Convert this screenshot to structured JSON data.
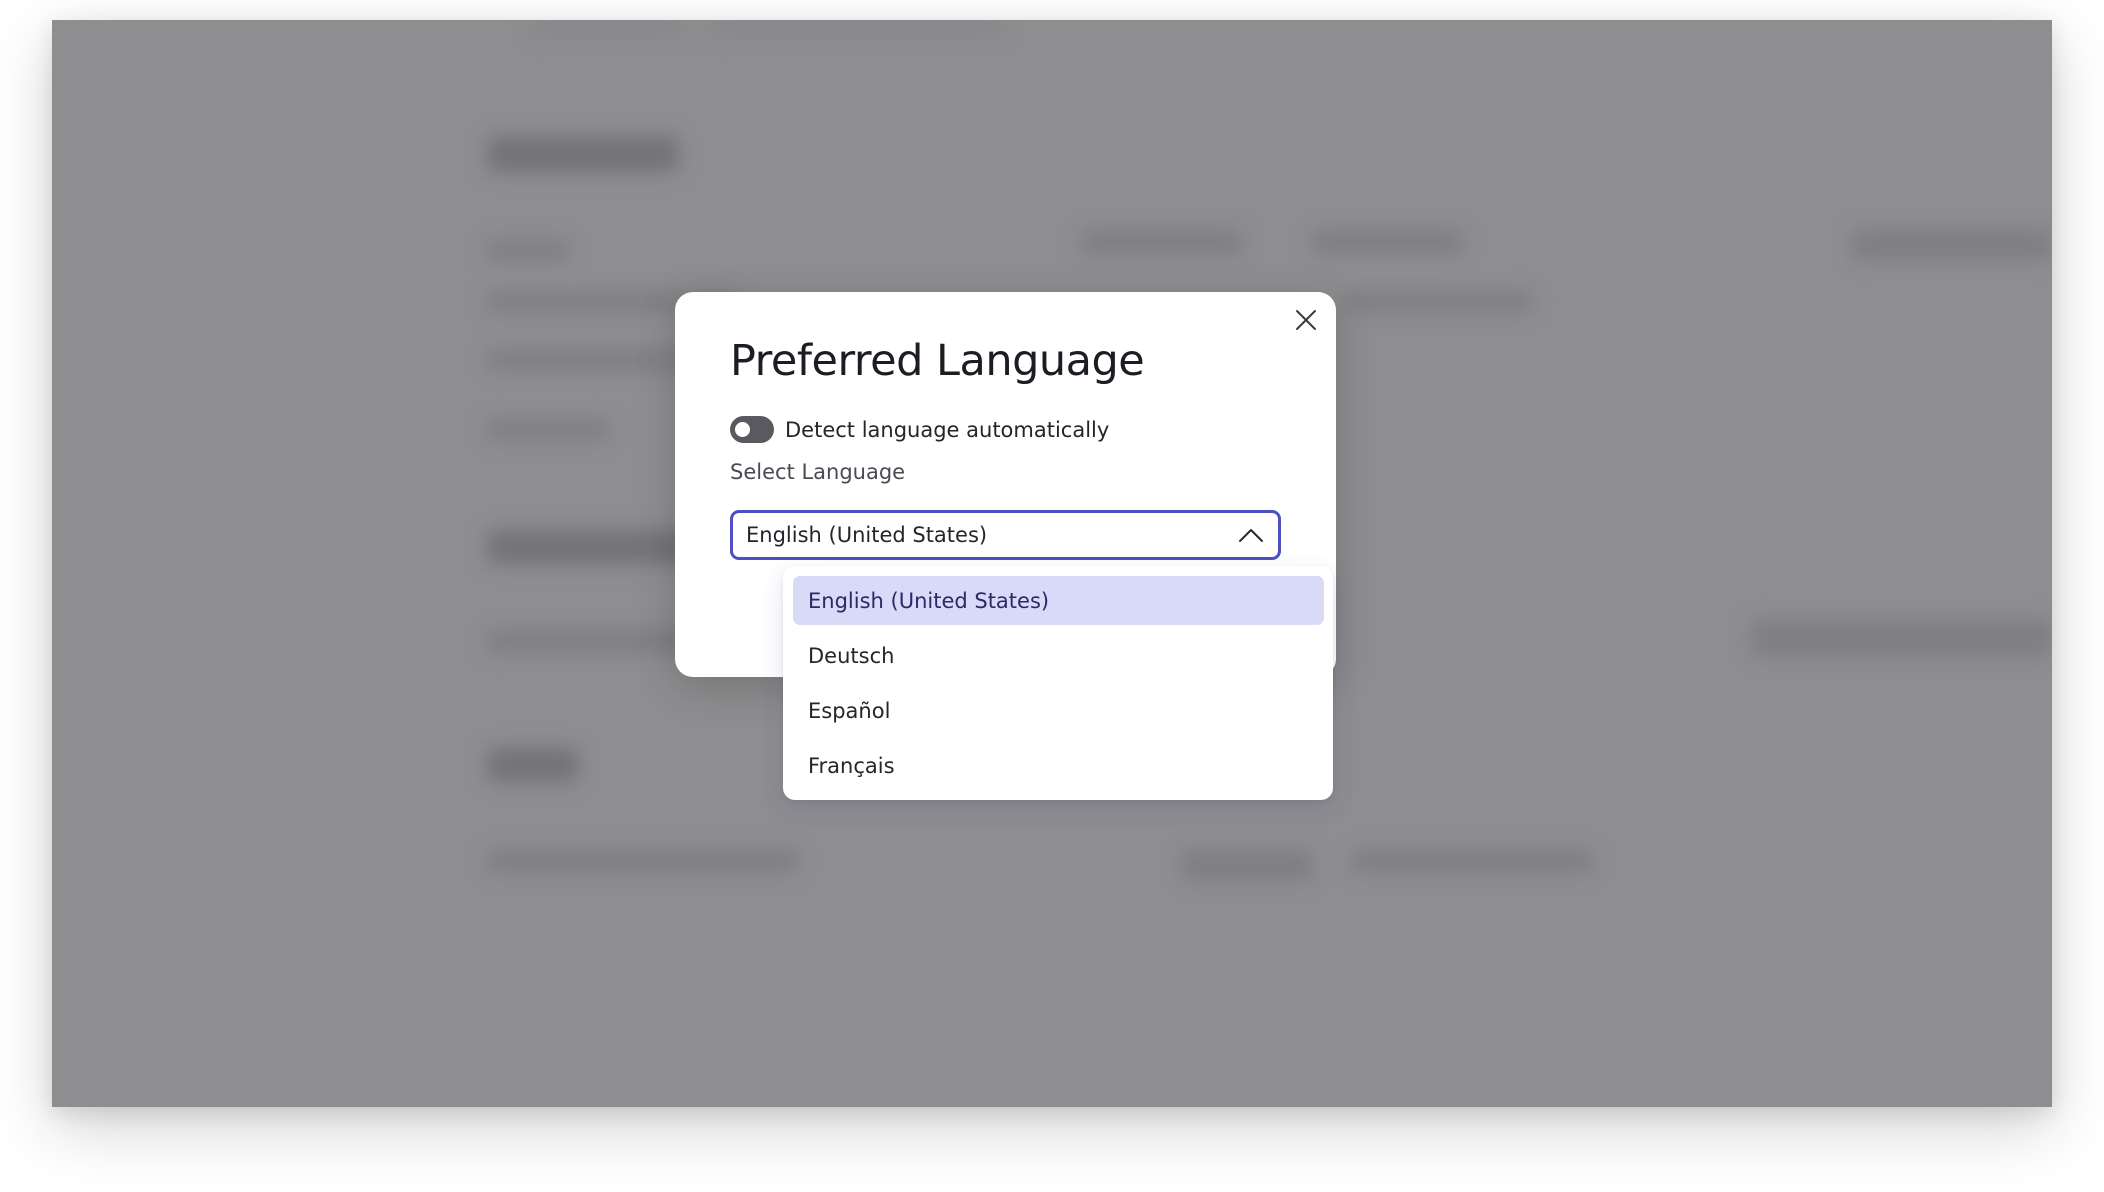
{
  "modal": {
    "title": "Preferred Language",
    "close_icon": "close-icon",
    "auto_detect": {
      "label": "Detect language automatically",
      "enabled": false
    },
    "select": {
      "label": "Select Language",
      "value": "English (United States)",
      "expanded": true,
      "icon": "chevron-up-icon"
    }
  },
  "dropdown": {
    "options": [
      {
        "label": "English (United States)",
        "selected": true
      },
      {
        "label": "Deutsch",
        "selected": false
      },
      {
        "label": "Español",
        "selected": false
      },
      {
        "label": "Français",
        "selected": false
      }
    ]
  },
  "colors": {
    "overlay": "#8e8d8f",
    "accent": "#4d4fc4",
    "selected_option_bg": "#d9d9f8",
    "toggle_off": "#5a5960"
  }
}
